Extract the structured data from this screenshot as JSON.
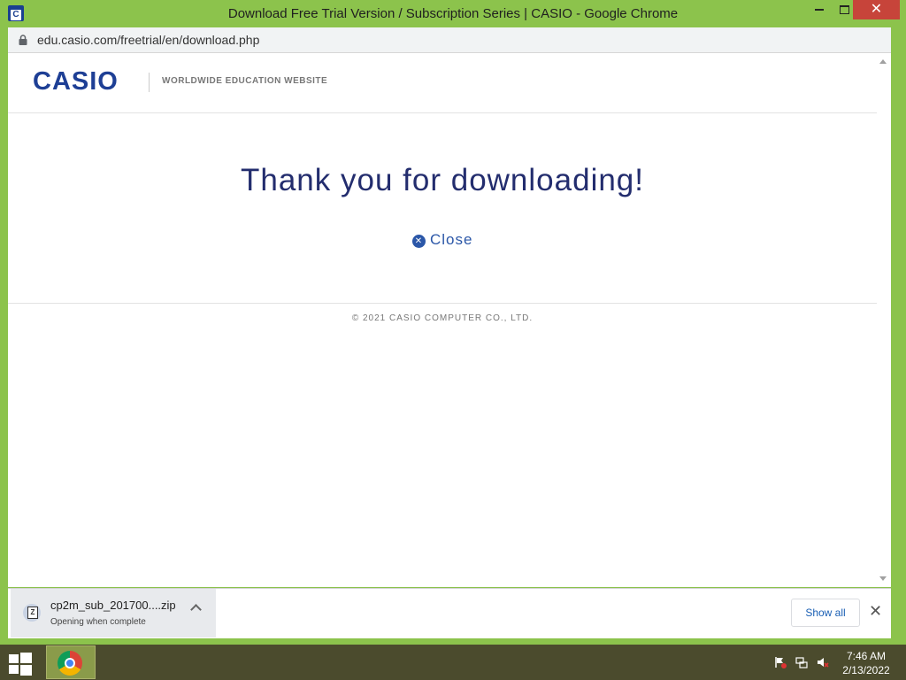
{
  "window": {
    "app_icon": "C",
    "title": "Download Free Trial Version / Subscription Series | CASIO - Google Chrome",
    "close_glyph": "✕"
  },
  "address_bar": {
    "url": "edu.casio.com/freetrial/en/download.php",
    "lock_icon": "lock-icon"
  },
  "page": {
    "logo": "CASIO",
    "tagline": "WORLDWIDE EDUCATION WEBSITE",
    "heading": "Thank you for downloading!",
    "close_label": "Close",
    "copyright": "© 2021 CASIO COMPUTER CO., LTD."
  },
  "downloads": {
    "file_name": "cp2m_sub_201700....zip",
    "status": "Opening when complete",
    "file_icon_letter": "Z",
    "show_all_label": "Show all",
    "close_glyph": "✕"
  },
  "taskbar": {
    "time": "7:46 AM",
    "date": "2/13/2022"
  },
  "colors": {
    "frame": "#8cc34c",
    "brand_blue": "#1e3f95",
    "heading": "#232d6e",
    "link": "#2b57a8",
    "taskbar": "#4b4b2d"
  }
}
